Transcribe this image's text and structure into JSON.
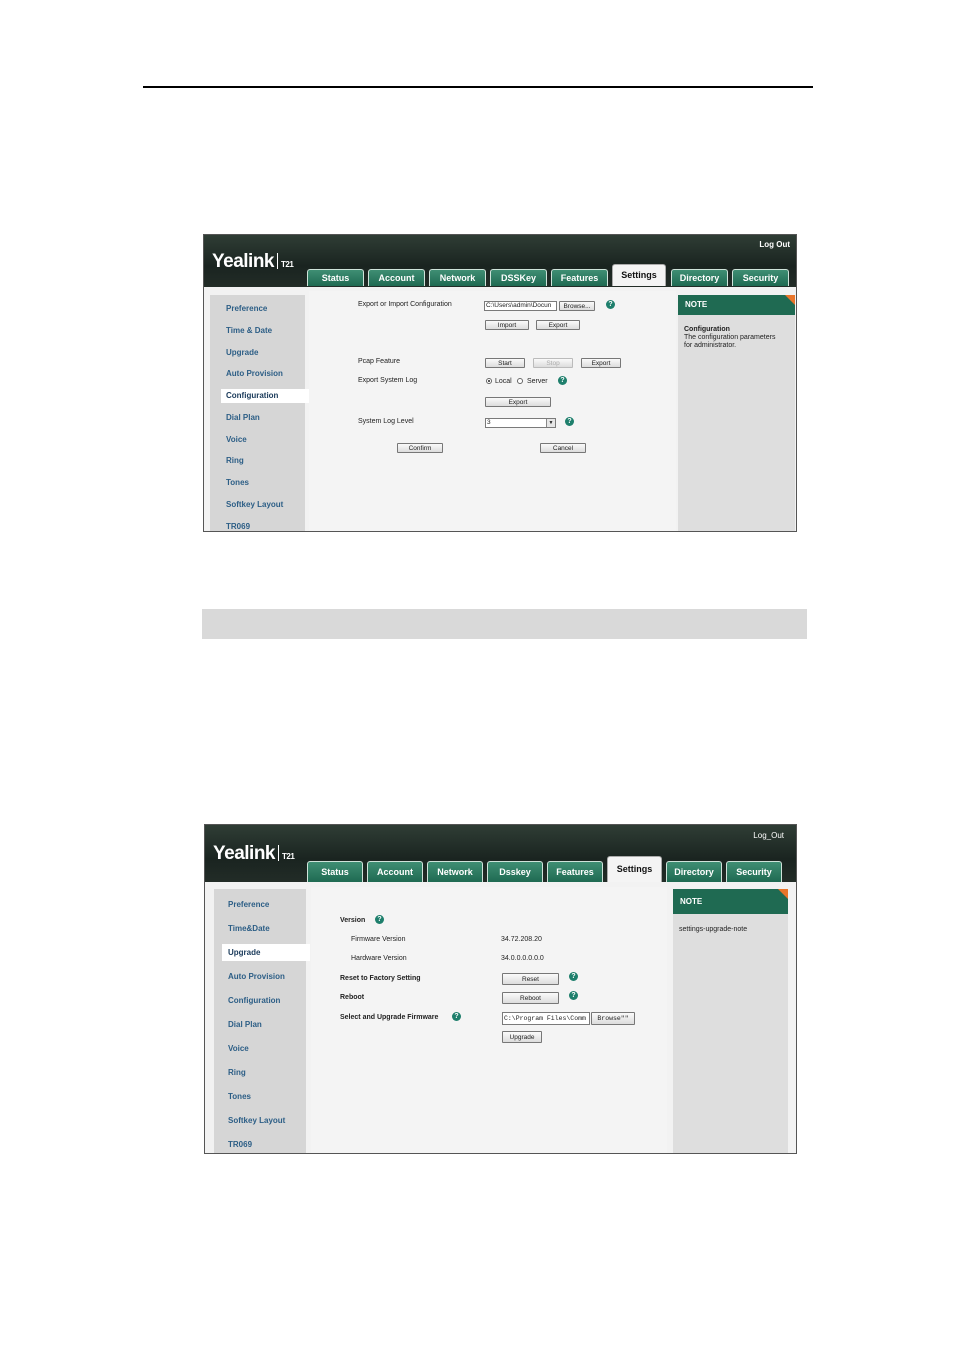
{
  "screenshot1": {
    "brand": "Yealink",
    "model": "T21",
    "logout": "Log Out",
    "tabs": [
      "Status",
      "Account",
      "Network",
      "DSSKey",
      "Features",
      "Settings",
      "Directory",
      "Security"
    ],
    "active_tab": "Settings",
    "sidebar": [
      "Preference",
      "Time & Date",
      "Upgrade",
      "Auto Provision",
      "Configuration",
      "Dial Plan",
      "Voice",
      "Ring",
      "Tones",
      "Softkey Layout",
      "TR069"
    ],
    "active_sidebar": "Configuration",
    "form": {
      "export_import_label": "Export or Import Configuration",
      "file_value": "C:\\Users\\admin\\Docun",
      "browse": "Browse...",
      "import": "Import",
      "export": "Export",
      "pcap_label": "Pcap Feature",
      "start": "Start",
      "stop": "Stop",
      "pcap_export": "Export",
      "export_log_label": "Export System Log",
      "local": "Local",
      "server": "Server",
      "log_export": "Export",
      "log_level_label": "System Log Level",
      "log_level_value": "3",
      "confirm": "Confirm",
      "cancel": "Cancel"
    },
    "note": {
      "head": "NOTE",
      "title": "Configuration",
      "text": "The configuration parameters for administrator."
    }
  },
  "screenshot2": {
    "brand": "Yealink",
    "model": "T21",
    "logout": "Log_Out",
    "tabs": [
      "Status",
      "Account",
      "Network",
      "Dsskey",
      "Features",
      "Settings",
      "Directory",
      "Security"
    ],
    "active_tab": "Settings",
    "sidebar": [
      "Preference",
      "Time&Date",
      "Upgrade",
      "Auto Provision",
      "Configuration",
      "Dial Plan",
      "Voice",
      "Ring",
      "Tones",
      "Softkey Layout",
      "TR069"
    ],
    "active_sidebar": "Upgrade",
    "form": {
      "version_label": "Version",
      "firmware_label": "Firmware Version",
      "firmware_value": "34.72.208.20",
      "hardware_label": "Hardware Version",
      "hardware_value": "34.0.0.0.0.0.0",
      "reset_label": "Reset to Factory Setting",
      "reset": "Reset",
      "reboot_label": "Reboot",
      "reboot": "Reboot",
      "upgrade_label": "Select and Upgrade Firmware",
      "file_value": "C:\\Program Files\\Comm",
      "browse": "Browse\"\"",
      "upgrade": "Upgrade"
    },
    "note": {
      "head": "NOTE",
      "text": "settings-upgrade-note"
    }
  }
}
